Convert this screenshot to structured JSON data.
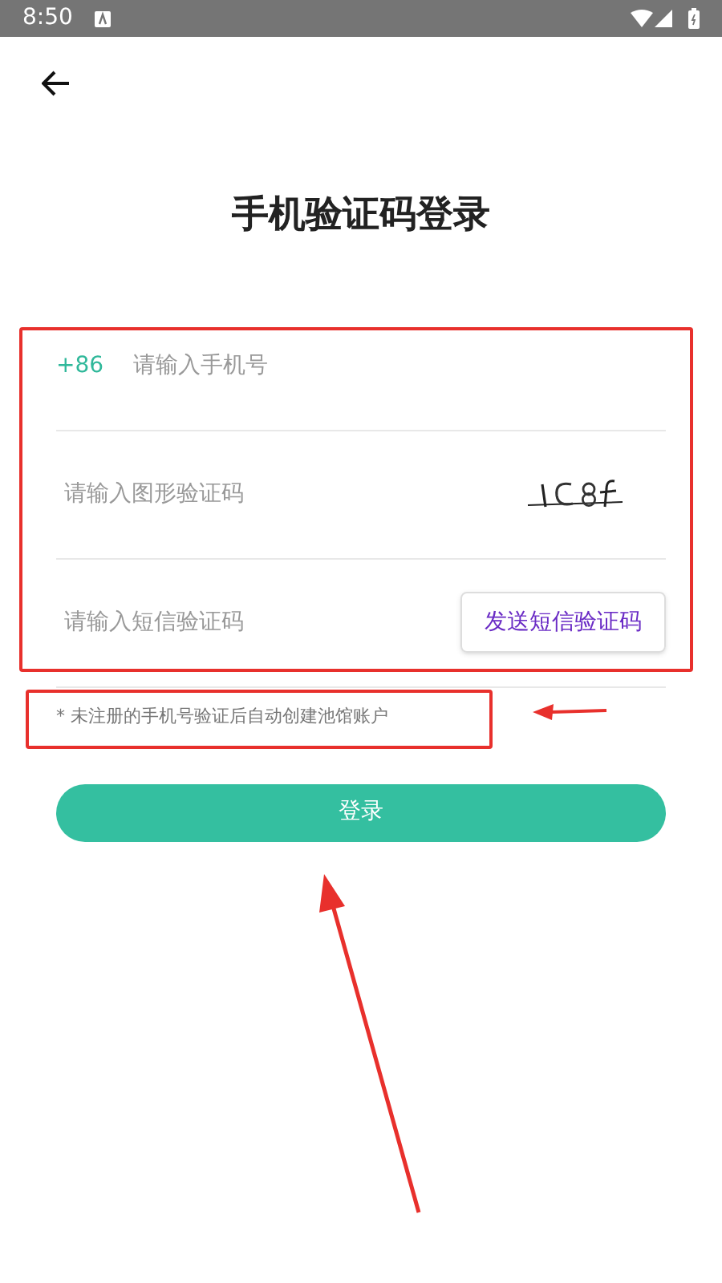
{
  "status_bar": {
    "time": "8:50"
  },
  "title": "手机验证码登录",
  "phone": {
    "prefix": "+86",
    "placeholder": "请输入手机号"
  },
  "captcha": {
    "placeholder": "请输入图形验证码"
  },
  "sms": {
    "placeholder": "请输入短信验证码",
    "button": "发送短信验证码"
  },
  "hint": "* 未注册的手机号验证后自动创建池馆账户",
  "login_button": "登录"
}
